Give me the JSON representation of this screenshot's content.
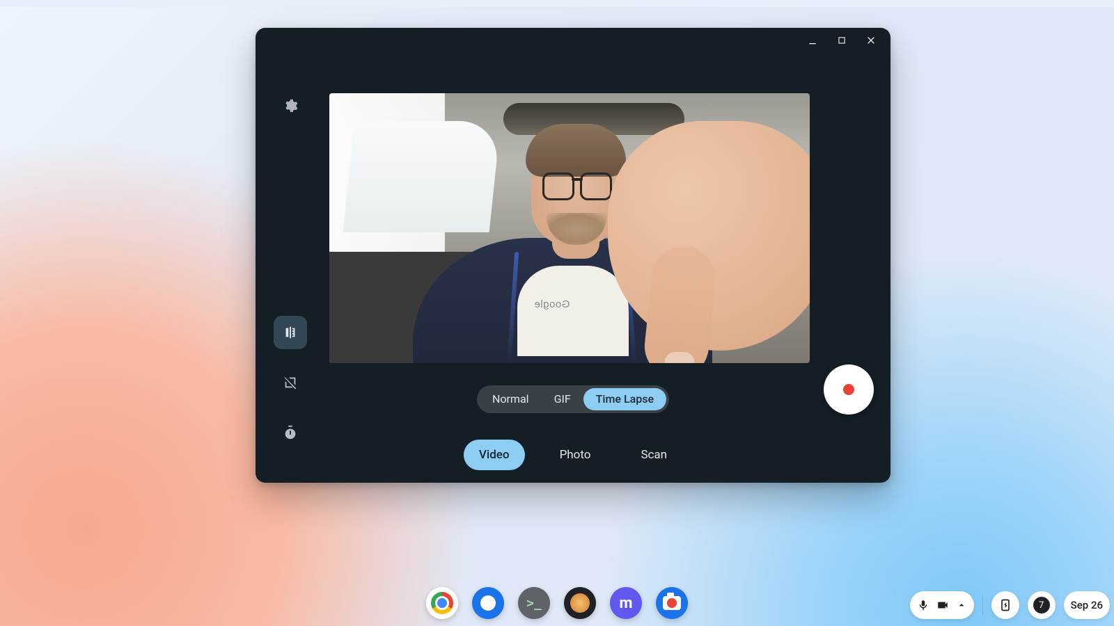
{
  "sidebar": {
    "settings_tooltip": "Settings",
    "mirror_tooltip": "Mirror",
    "grid_tooltip": "Grid",
    "timer_tooltip": "Timer"
  },
  "submodes": {
    "items": [
      {
        "label": "Normal",
        "active": false
      },
      {
        "label": "GIF",
        "active": false
      },
      {
        "label": "Time Lapse",
        "active": true
      }
    ]
  },
  "modes": {
    "items": [
      {
        "label": "Video",
        "active": true
      },
      {
        "label": "Photo",
        "active": false
      },
      {
        "label": "Scan",
        "active": false
      }
    ]
  },
  "preview": {
    "shirt_logo": "Google"
  },
  "shelf": {
    "apps": [
      "Chrome",
      "Files",
      "Terminal",
      "App",
      "Mastodon",
      "Camera"
    ],
    "notifications_count": "7",
    "date_label": "Sep 26"
  }
}
